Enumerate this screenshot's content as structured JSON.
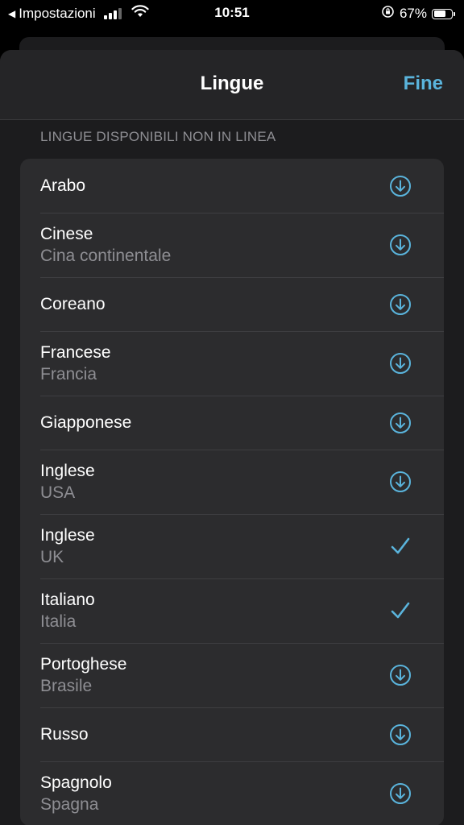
{
  "status_bar": {
    "back_label": "Impostazioni",
    "time": "10:51",
    "battery_percent": "67%",
    "battery_level": 0.67
  },
  "nav": {
    "title": "Lingue",
    "done_label": "Fine"
  },
  "section": {
    "header": "LINGUE DISPONIBILI NON IN LINEA"
  },
  "languages": [
    {
      "name": "Arabo",
      "region": "",
      "status": "download"
    },
    {
      "name": "Cinese",
      "region": "Cina continentale",
      "status": "download"
    },
    {
      "name": "Coreano",
      "region": "",
      "status": "download"
    },
    {
      "name": "Francese",
      "region": "Francia",
      "status": "download"
    },
    {
      "name": "Giapponese",
      "region": "",
      "status": "download"
    },
    {
      "name": "Inglese",
      "region": "USA",
      "status": "download"
    },
    {
      "name": "Inglese",
      "region": "UK",
      "status": "downloaded"
    },
    {
      "name": "Italiano",
      "region": "Italia",
      "status": "downloaded"
    },
    {
      "name": "Portoghese",
      "region": "Brasile",
      "status": "download"
    },
    {
      "name": "Russo",
      "region": "",
      "status": "download"
    },
    {
      "name": "Spagnolo",
      "region": "Spagna",
      "status": "download"
    }
  ],
  "colors": {
    "accent": "#5ab4dc",
    "background": "#1c1c1e",
    "cell": "#2c2c2e",
    "secondary_text": "#8e8e93"
  },
  "icons": {
    "download": "download-circle-icon",
    "downloaded": "checkmark-icon"
  }
}
